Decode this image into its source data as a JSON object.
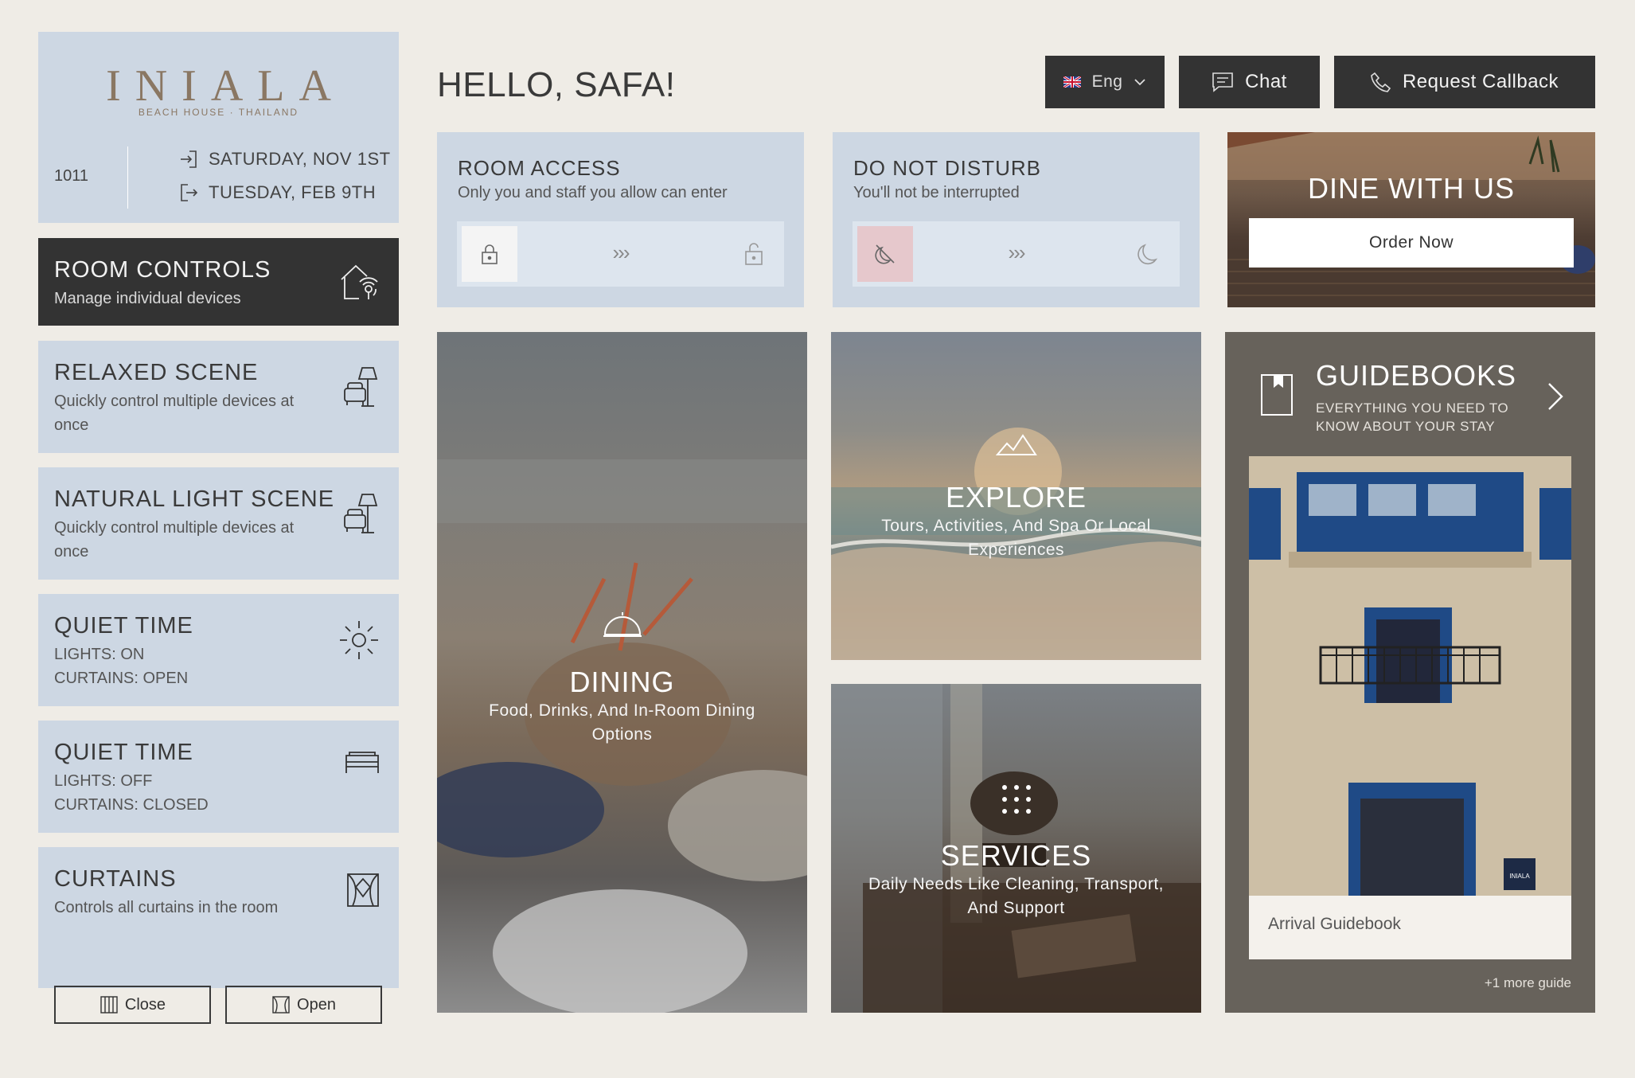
{
  "hotel": {
    "logo": "INIALA",
    "logo_sub": "BEACH HOUSE · THAILAND",
    "room_number": "1011",
    "check_in": "SATURDAY, NOV 1ST",
    "check_out": "TUESDAY, FEB 9TH"
  },
  "greeting": "HELLO, SAFA!",
  "topbar": {
    "language": "Eng",
    "chat": "Chat",
    "callback": "Request Callback"
  },
  "left_tiles": [
    {
      "title": "ROOM CONTROLS",
      "sub": "Manage individual devices"
    },
    {
      "title": "RELAXED SCENE",
      "sub": "Quickly control multiple devices at once"
    },
    {
      "title": "NATURAL LIGHT SCENE",
      "sub": "Quickly control multiple devices at once"
    },
    {
      "title": "QUIET TIME",
      "line1": "LIGHTS: ON",
      "line2": "CURTAINS: OPEN"
    },
    {
      "title": "QUIET TIME",
      "line1": "LIGHTS: OFF",
      "line2": "CURTAINS: CLOSED"
    },
    {
      "title": "CURTAINS",
      "sub": "Controls all curtains in the room",
      "close": "Close",
      "open": "Open"
    }
  ],
  "room_access": {
    "title": "ROOM ACCESS",
    "sub": "Only you and staff you allow can enter",
    "arrows": "›››"
  },
  "dnd": {
    "title": "DO NOT DISTURB",
    "sub": "You'll not be interrupted",
    "arrows": "›››"
  },
  "dine": {
    "title": "DINE WITH US",
    "button": "Order Now"
  },
  "dining": {
    "title": "DINING",
    "sub": "Food, Drinks, And In-Room Dining Options"
  },
  "explore": {
    "title": "EXPLORE",
    "sub": "Tours, Activities, And Spa Or Local Experiences"
  },
  "services": {
    "title": "SERVICES",
    "sub": "Daily Needs Like Cleaning, Transport, And Support"
  },
  "guidebooks": {
    "title": "GUIDEBOOKS",
    "sub": "EVERYTHING YOU NEED TO KNOW ABOUT YOUR STAY",
    "item": "Arrival Guidebook",
    "more": "+1 more guide",
    "sign": "INIALA"
  },
  "colors": {
    "tile": "#cdd7e3",
    "dark": "#333333",
    "background": "#efece6",
    "brand": "#8a7763",
    "dnd_knob": "#e6c8cc",
    "guides_panel": "#67625b"
  }
}
